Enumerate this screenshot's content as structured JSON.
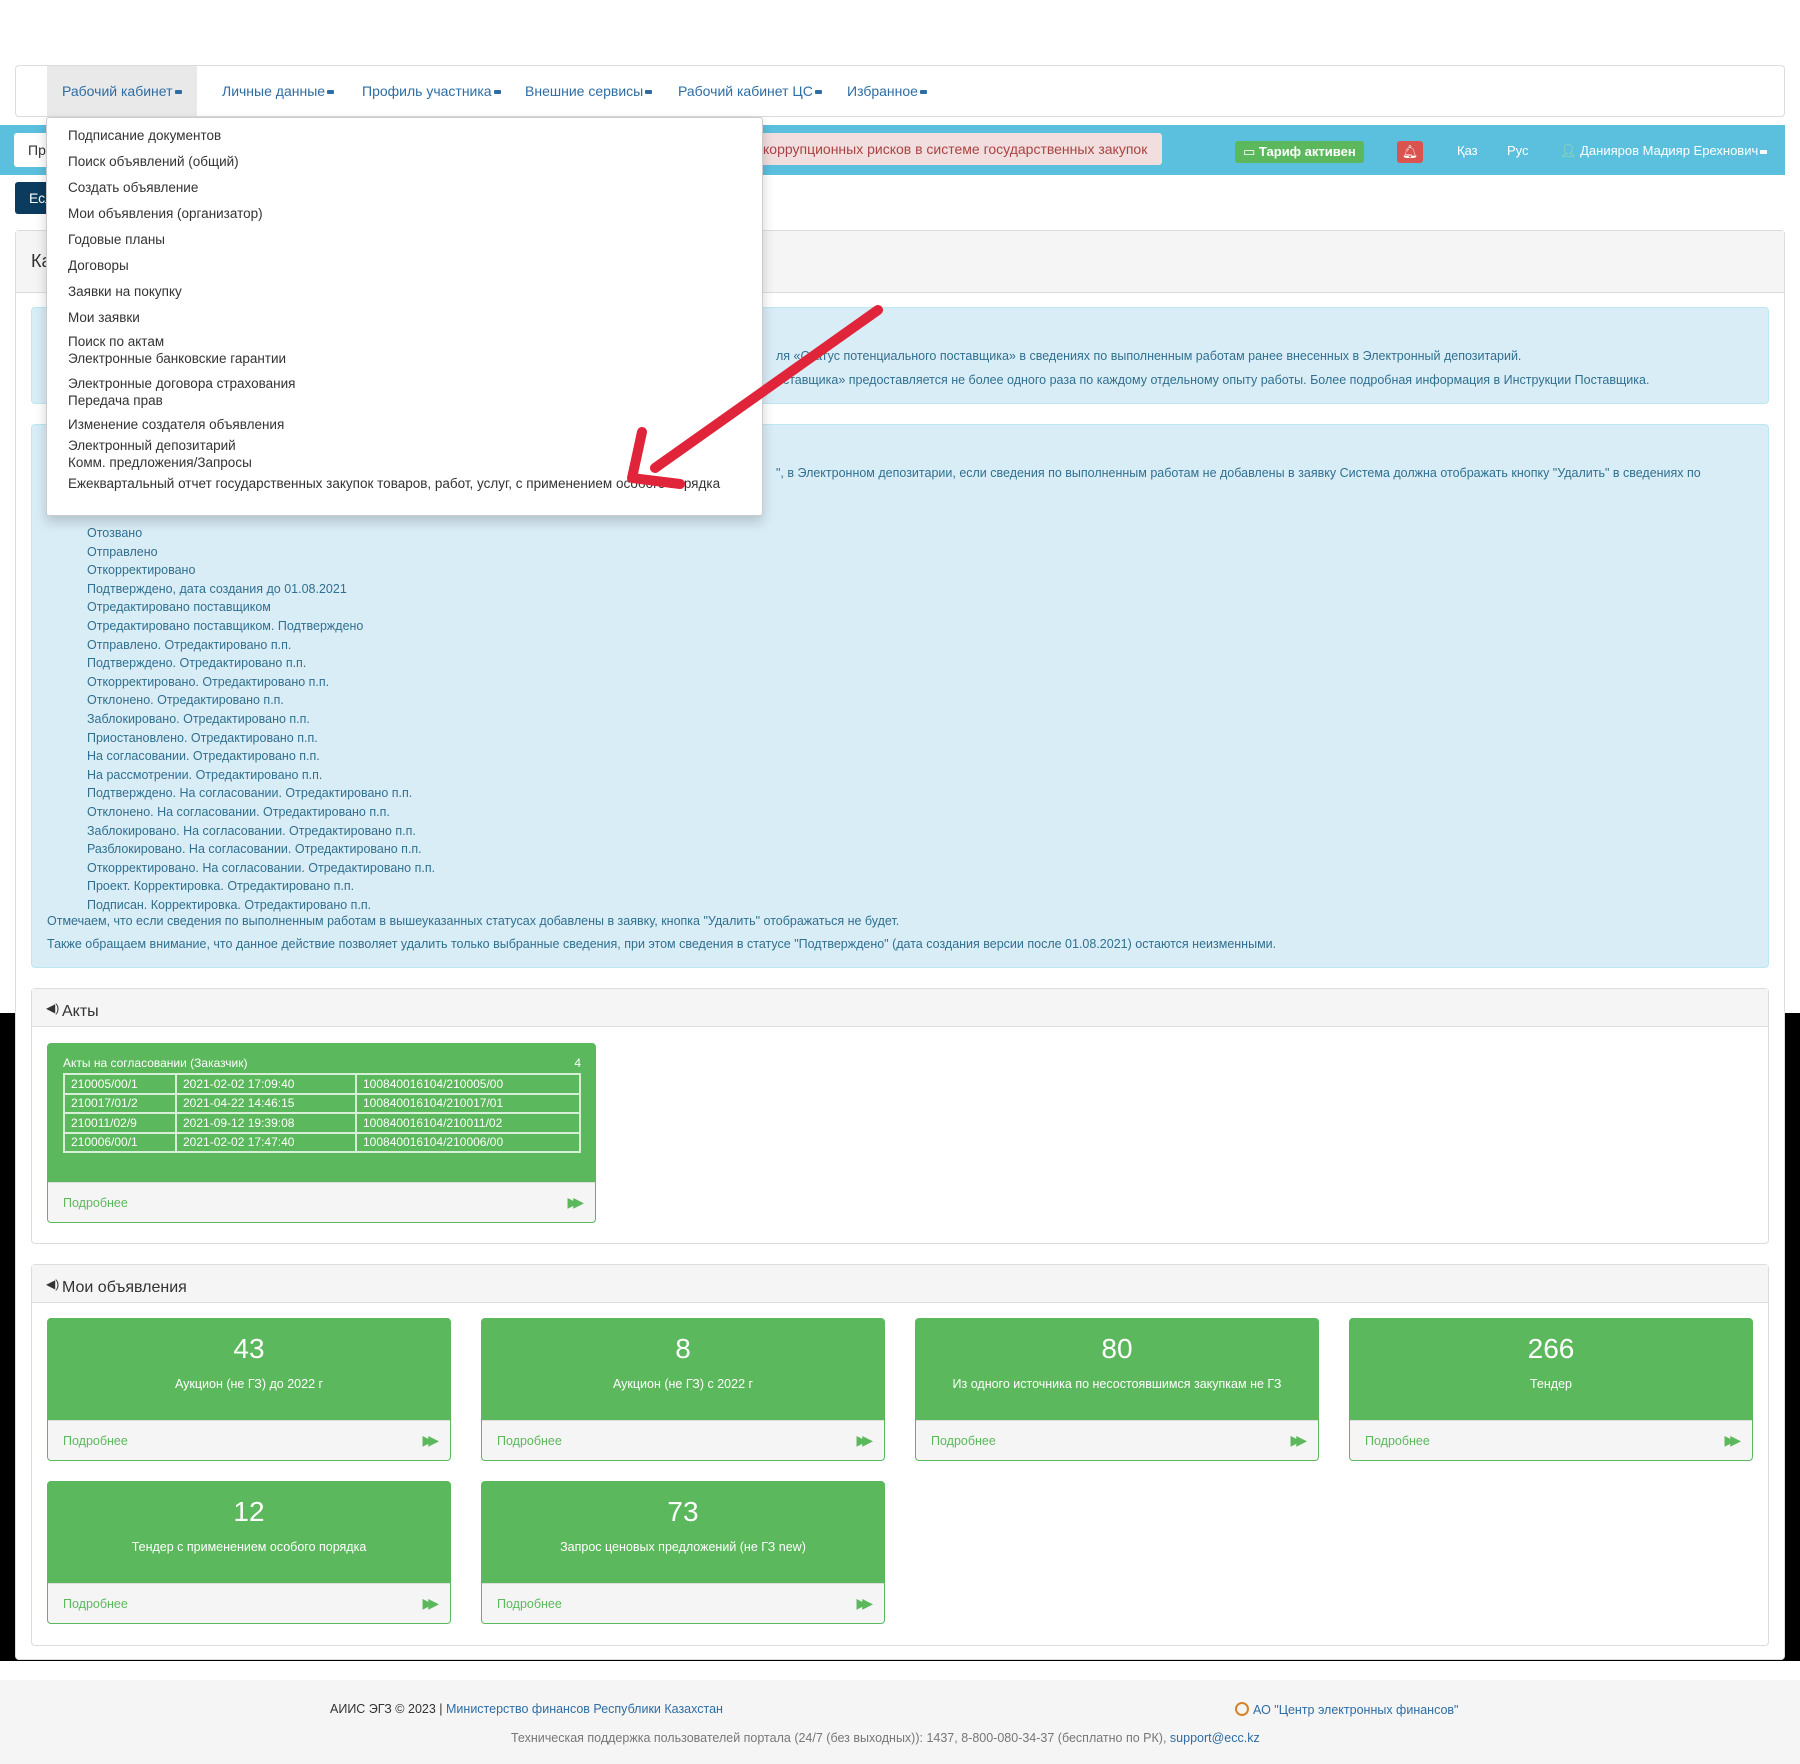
{
  "nav": {
    "items": [
      "Рабочий кабинет",
      "Личные данные",
      "Профиль участника",
      "Внешние сервисы",
      "Рабочий кабинет ЦС",
      "Избранное"
    ]
  },
  "dropdown": {
    "items": [
      "Подписание документов",
      "Поиск объявлений (общий)",
      "Создать объявление",
      "Мои объявления (организатор)",
      "Годовые планы",
      "Договоры",
      "Заявки на покупку",
      "Мои заявки",
      "Поиск по актам",
      "Электронные банковские гарантии",
      "Электронные договора страхования",
      "Передача прав",
      "Изменение создателя объявления",
      "Электронный депозитарий",
      "Комм. предложения/Запросы",
      "Ежеквартальный отчет государственных закупок товаров, работ, услуг, с применением особого порядка"
    ]
  },
  "topbar": {
    "search_text": "Пр",
    "alert_text": "коррупционных рисков в системе государственных закупок",
    "tariff": "Тариф активен",
    "lang_kz": "Қаз",
    "lang_ru": "Рус",
    "user_name": "Данияров Мадияр Ерехнович",
    "dark_button": "Есл"
  },
  "main": {
    "title": "Ка",
    "info1": [
      "ля «Статус потенциального поставщика» в сведениях по выполненным работам ранее внесенных в Электронный депозитарий.",
      "оставщика» предоставляется не более одного раза по каждому отдельному опыту работы. Более подробная информация в Инструкции Поставщика."
    ],
    "info2_first": "\", в Электронном депозитарии, если сведения по выполненным работам не добавлены в заявку Система должна отображать кнопку \"Удалить\" в сведениях по",
    "statuses": [
      "Отозвано",
      "Отправлено",
      "Откорректировано",
      "Подтверждено, дата создания до 01.08.2021",
      "Отредактировано поставщиком",
      "Отредактировано поставщиком. Подтверждено",
      "Отправлено. Отредактировано п.п.",
      "Подтверждено. Отредактировано п.п.",
      "Откорректировано. Отредактировано п.п.",
      "Отклонено. Отредактировано п.п.",
      "Заблокировано. Отредактировано п.п.",
      "Приостановлено. Отредактировано п.п.",
      "На согласовании. Отредактировано п.п.",
      "На рассмотрении. Отредактировано п.п.",
      "Подтверждено. На согласовании. Отредактировано п.п.",
      "Отклонено. На согласовании. Отредактировано п.п.",
      "Заблокировано. На согласовании. Отредактировано п.п.",
      "Разблокировано. На согласовании. Отредактировано п.п.",
      "Откорректировано. На согласовании. Отредактировано п.п.",
      "Проект. Корректировка. Отредактировано п.п.",
      "Подписан. Корректировка. Отредактировано п.п."
    ],
    "note1": "Отмечаем, что если сведения по выполненным работам в вышеуказанных статусах добавлены в заявку, кнопка \"Удалить\" отображаться не будет.",
    "note2": "Также обращаем внимание, что данное действие позволяет удалить только выбранные сведения, при этом сведения в статусе \"Подтверждено\" (дата создания версии после 01.08.2021) остаются неизменными."
  },
  "akty": {
    "title": "Акты",
    "caption": "Акты на согласовании (Заказчик)",
    "count": "4",
    "rows": [
      [
        "210005/00/1",
        "2021-02-02 17:09:40",
        "100840016104/210005/00"
      ],
      [
        "210017/01/2",
        "2021-04-22 14:46:15",
        "100840016104/210017/01"
      ],
      [
        "210011/02/9",
        "2021-09-12 19:39:08",
        "100840016104/210011/02"
      ],
      [
        "210006/00/1",
        "2021-02-02 17:47:40",
        "100840016104/210006/00"
      ]
    ],
    "more": "Подробнее"
  },
  "ads": {
    "title": "Мои объявления",
    "more": "Подробнее",
    "tiles": [
      {
        "num": "43",
        "label": "Аукцион (не ГЗ) до 2022 г"
      },
      {
        "num": "8",
        "label": "Аукцион (не ГЗ) с 2022 г"
      },
      {
        "num": "80",
        "label": "Из одного источника по несостоявшимся закупкам не ГЗ"
      },
      {
        "num": "266",
        "label": "Тендер"
      },
      {
        "num": "12",
        "label": "Тендер с применением особого порядка"
      },
      {
        "num": "73",
        "label": "Запрос ценовых предложений (не ГЗ new)"
      }
    ]
  },
  "footer": {
    "copyright": "АИИС ЭГЗ © 2023 |",
    "ministry": "Министерство финансов Республики Казахстан",
    "ecc": "АО \"Центр электронных финансов\"",
    "support": "Техническая поддержка пользователей портала (24/7 (без выходных)): 1437, 8-800-080-34-37 (бесплатно по РК),",
    "email": "support@ecc.kz"
  },
  "colors": {
    "teal": "#5bc0de",
    "green": "#5cb85c",
    "link": "#2e6da4",
    "annotation_arrow": "#e0243a"
  }
}
